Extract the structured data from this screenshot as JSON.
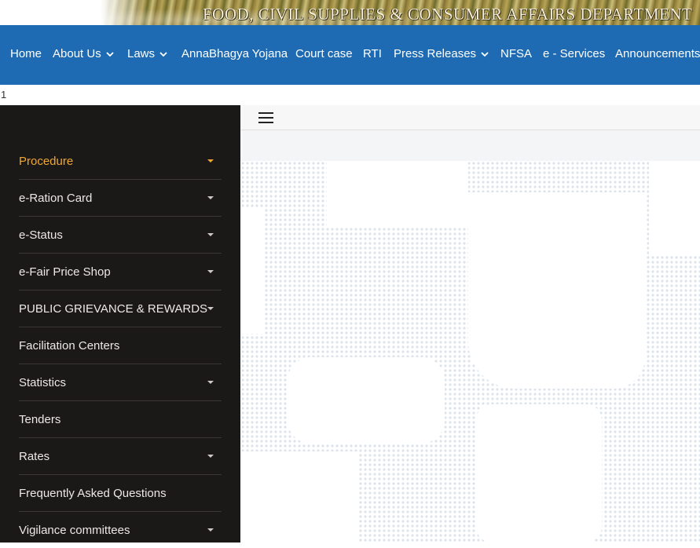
{
  "header": {
    "banner_title": "FOOD, CIVIL SUPPLIES & CONSUMER AFFAIRS DEPARTMENT"
  },
  "nav": {
    "items": [
      {
        "label": "Home"
      },
      {
        "label": "About Us"
      },
      {
        "label": "Laws"
      },
      {
        "label": "AnnaBhagya Yojana"
      },
      {
        "label": "Court case"
      },
      {
        "label": "RTI"
      },
      {
        "label": "Press Releases"
      },
      {
        "label": "NFSA"
      },
      {
        "label": "e - Services"
      },
      {
        "label": "Announcements"
      }
    ]
  },
  "counter": "1",
  "sidebar": {
    "items": [
      {
        "label": "Procedure"
      },
      {
        "label": "e-Ration Card"
      },
      {
        "label": "e-Status"
      },
      {
        "label": "e-Fair Price Shop"
      },
      {
        "label": "PUBLIC GRIEVANCE & REWARDS"
      },
      {
        "label": "Facilitation Centers"
      },
      {
        "label": "Statistics"
      },
      {
        "label": "Tenders"
      },
      {
        "label": "Rates"
      },
      {
        "label": "Frequently Asked Questions"
      },
      {
        "label": "Vigilance committees"
      }
    ]
  },
  "colors": {
    "nav_bg": "#1f6bb3",
    "sidebar_bg": "#1b1818",
    "active_item": "#f0a830",
    "map_dots": "#dde3ea"
  },
  "icons": {
    "menu_toggle": "hamburger-icon",
    "dropdown": "chevron-down-icon",
    "submenu": "caret-down-icon"
  }
}
